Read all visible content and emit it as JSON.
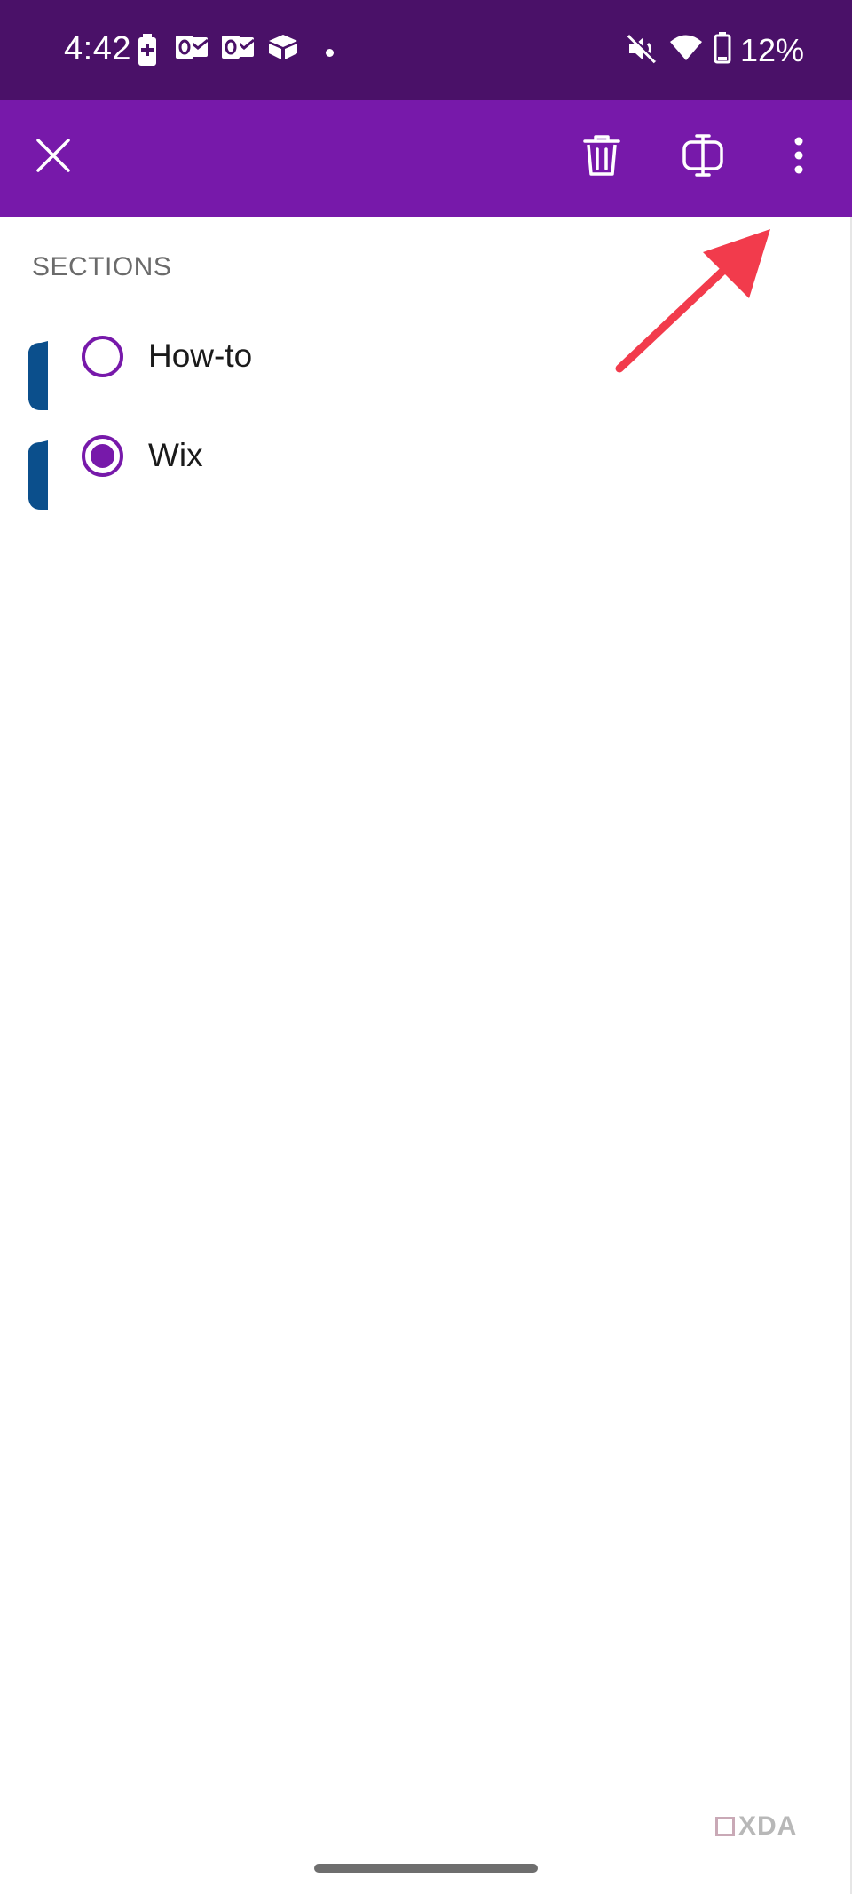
{
  "status_bar": {
    "time": "4:42",
    "battery_percent": "12%",
    "notification_icons": [
      "battery-saver-icon",
      "outlook-icon",
      "outlook-icon",
      "box-icon",
      "dot-icon"
    ],
    "system_icons": [
      "mute-icon",
      "wifi-icon",
      "battery-icon"
    ]
  },
  "toolbar": {
    "background_color": "#7719aa",
    "actions": [
      "close-icon",
      "delete-icon",
      "split-view-icon",
      "more-options-icon"
    ]
  },
  "sections": {
    "header": "SECTIONS",
    "items": [
      {
        "label": "How-to",
        "selected": false,
        "tab_color": "#0b4f8c"
      },
      {
        "label": "Wix",
        "selected": true,
        "tab_color": "#0b4f8c"
      }
    ]
  },
  "annotation": {
    "type": "red-arrow",
    "color": "#f23b4c",
    "points_to": "more-options-icon"
  },
  "watermark": {
    "text": "XDA"
  }
}
